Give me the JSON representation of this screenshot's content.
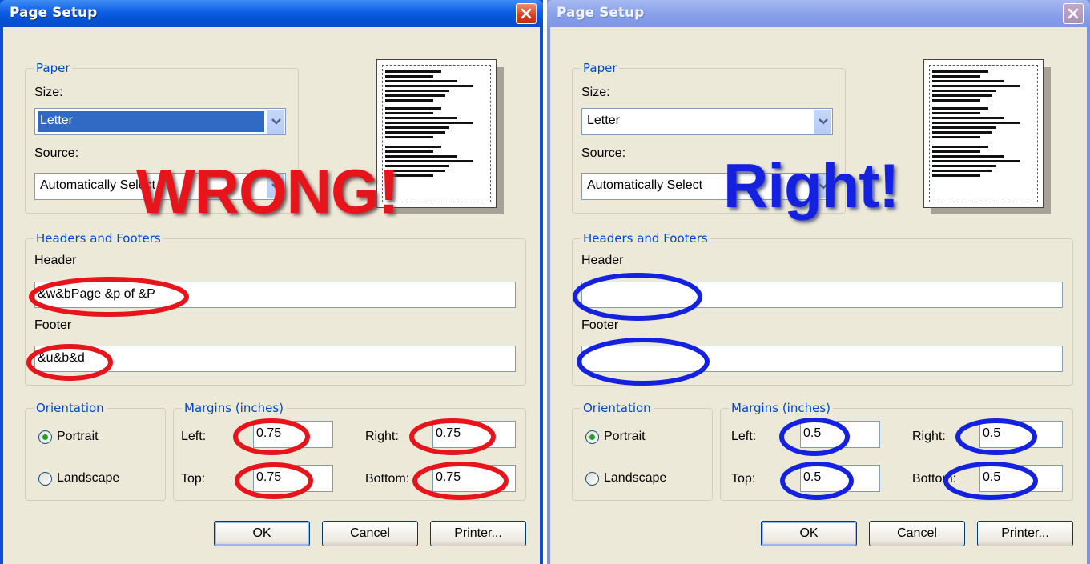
{
  "left_dialog": {
    "title": "Page Setup",
    "paper": {
      "legend": "Paper",
      "size_label": "Size:",
      "size_value": "Letter",
      "source_label": "Source:",
      "source_value": "Automatically Select"
    },
    "headers_footers": {
      "legend": "Headers and Footers",
      "header_label": "Header",
      "header_value": "&w&bPage &p of &P",
      "footer_label": "Footer",
      "footer_value": "&u&b&d"
    },
    "orientation": {
      "legend": "Orientation",
      "portrait": "Portrait",
      "landscape": "Landscape",
      "selected": "portrait"
    },
    "margins": {
      "legend": "Margins (inches)",
      "left_label": "Left:",
      "left_value": "0.75",
      "right_label": "Right:",
      "right_value": "0.75",
      "top_label": "Top:",
      "top_value": "0.75",
      "bottom_label": "Bottom:",
      "bottom_value": "0.75"
    },
    "buttons": {
      "ok": "OK",
      "cancel": "Cancel",
      "printer": "Printer..."
    },
    "annotation": {
      "word": "WRONG!",
      "color": "#e8141c"
    }
  },
  "right_dialog": {
    "title": "Page Setup",
    "paper": {
      "legend": "Paper",
      "size_label": "Size:",
      "size_value": "Letter",
      "source_label": "Source:",
      "source_value": "Automatically Select"
    },
    "headers_footers": {
      "legend": "Headers and Footers",
      "header_label": "Header",
      "header_value": "",
      "footer_label": "Footer",
      "footer_value": ""
    },
    "orientation": {
      "legend": "Orientation",
      "portrait": "Portrait",
      "landscape": "Landscape",
      "selected": "portrait"
    },
    "margins": {
      "legend": "Margins (inches)",
      "left_label": "Left:",
      "left_value": "0.5",
      "right_label": "Right:",
      "right_value": "0.5",
      "top_label": "Top:",
      "top_value": "0.5",
      "bottom_label": "Bottom:",
      "bottom_value": "0.5"
    },
    "buttons": {
      "ok": "OK",
      "cancel": "Cancel",
      "printer": "Printer..."
    },
    "annotation": {
      "word": "Right!",
      "color": "#1422e0"
    }
  },
  "icons": [
    "close-icon",
    "chevron-down-icon",
    "page-preview-icon"
  ],
  "colors": {
    "legend_blue": "#0046d5",
    "titlebar_active": "#0553d6",
    "dialog_face": "#ece9d8"
  }
}
